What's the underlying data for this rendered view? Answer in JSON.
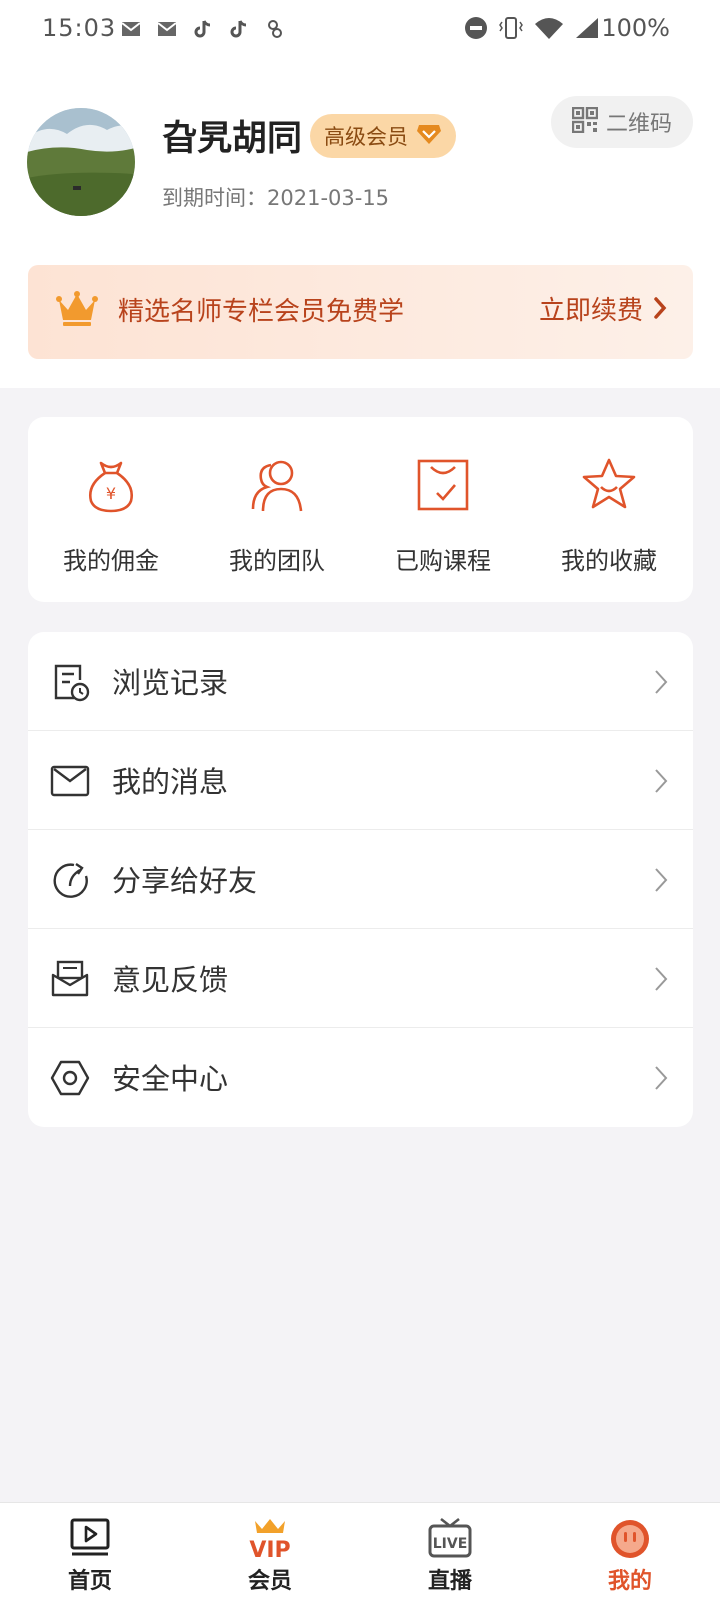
{
  "status_bar": {
    "time": "15:03",
    "battery": "100%",
    "icons": [
      "mail-icon",
      "mail-icon",
      "tiktok-icon",
      "tiktok-icon",
      "app-icon",
      "dnd-icon",
      "vibrate-icon",
      "wifi-icon",
      "signal-icon"
    ]
  },
  "profile": {
    "name": "旮旯胡同",
    "badge": "高级会员",
    "expire_text": "到期时间：2021-03-15",
    "qr_label": "二维码"
  },
  "promo": {
    "text": "精选名师专栏会员免费学",
    "action": "立即续费"
  },
  "quick_actions": [
    {
      "label": "我的佣金",
      "icon": "money-bag-icon"
    },
    {
      "label": "我的团队",
      "icon": "team-icon"
    },
    {
      "label": "已购课程",
      "icon": "purchased-course-icon"
    },
    {
      "label": "我的收藏",
      "icon": "star-icon"
    }
  ],
  "menu": [
    {
      "label": "浏览记录",
      "icon": "history-icon"
    },
    {
      "label": "我的消息",
      "icon": "message-icon"
    },
    {
      "label": "分享给好友",
      "icon": "share-icon"
    },
    {
      "label": "意见反馈",
      "icon": "feedback-icon"
    },
    {
      "label": "安全中心",
      "icon": "security-icon"
    }
  ],
  "tabs": [
    {
      "label": "首页",
      "icon": "home-play-icon",
      "active": false
    },
    {
      "label": "会员",
      "icon": "vip-crown-icon",
      "active": false
    },
    {
      "label": "直播",
      "icon": "live-tv-icon",
      "active": false
    },
    {
      "label": "我的",
      "icon": "profile-face-icon",
      "active": true
    }
  ],
  "colors": {
    "accent": "#e0542b",
    "promo_text": "#b8431c",
    "badge_bg": "#fbd7a6",
    "page_bg": "#f4f3f6"
  }
}
